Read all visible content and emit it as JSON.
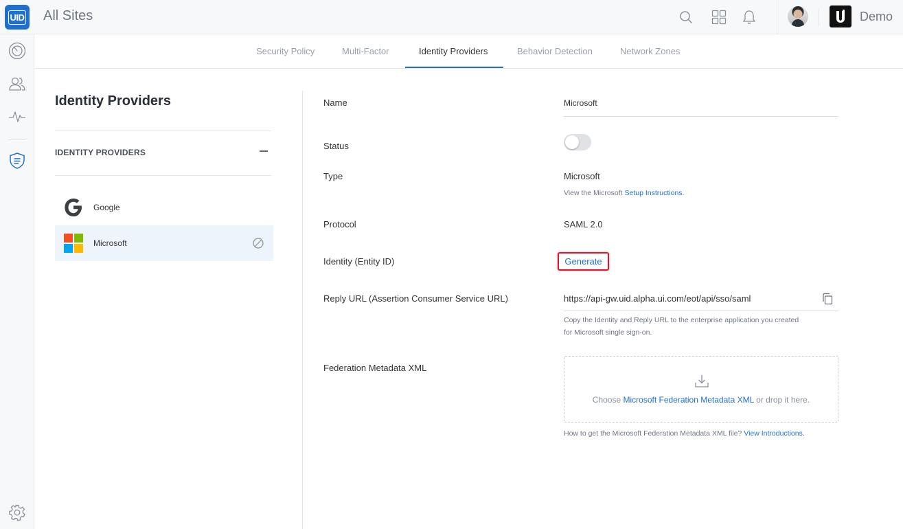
{
  "header": {
    "logo_text": "UID",
    "title": "All Sites",
    "org_name": "Demo",
    "org_logo_letter": "U"
  },
  "tabs": [
    {
      "label": "Security Policy"
    },
    {
      "label": "Multi-Factor"
    },
    {
      "label": "Identity Providers",
      "active": true
    },
    {
      "label": "Behavior Detection"
    },
    {
      "label": "Network Zones"
    }
  ],
  "sidebar_panel": {
    "title": "Identity Providers",
    "section_heading": "IDENTITY PROVIDERS",
    "items": [
      {
        "label": "Google",
        "icon": "google-logo-icon"
      },
      {
        "label": "Microsoft",
        "icon": "microsoft-logo-icon",
        "selected": true
      }
    ]
  },
  "form": {
    "name_label": "Name",
    "name_value": "Microsoft",
    "status_label": "Status",
    "status_enabled": false,
    "type_label": "Type",
    "type_value": "Microsoft",
    "type_hint_prefix": "View the Microsoft ",
    "type_hint_link": "Setup Instructions",
    "type_hint_suffix": ".",
    "protocol_label": "Protocol",
    "protocol_value": "SAML 2.0",
    "entity_label": "Identity (Entity ID)",
    "generate_label": "Generate",
    "reply_label": "Reply URL (Assertion Consumer Service URL)",
    "reply_value": "https://api-gw.uid.alpha.ui.com/eot/api/sso/saml",
    "reply_hint_line1": "Copy the Identity and Reply URL to the enterprise application you created",
    "reply_hint_line2": "for Microsoft single sign-on.",
    "metadata_label": "Federation Metadata XML",
    "drop_prefix": "Choose ",
    "drop_link": "Microsoft Federation Metadata XML",
    "drop_suffix": " or drop it here.",
    "metadata_hint_prefix": "How to get the Microsoft Federation Metadata XML file? ",
    "metadata_hint_link": "View Introductions."
  },
  "colors": {
    "accent": "#1f6fd1",
    "highlight_border": "#e0142b",
    "selected_bg": "#eef4fb"
  }
}
